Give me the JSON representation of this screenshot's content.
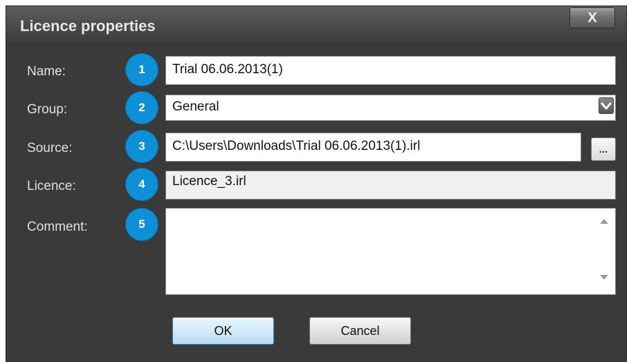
{
  "window": {
    "title": "Licence properties",
    "close_label": "X"
  },
  "fields": {
    "name": {
      "label": "Name:",
      "badge": "1",
      "value": "Trial 06.06.2013(1)"
    },
    "group": {
      "label": "Group:",
      "badge": "2",
      "value": "General"
    },
    "source": {
      "label": "Source:",
      "badge": "3",
      "value": "C:\\Users\\Downloads\\Trial 06.06.2013(1).irl",
      "browse_label": "..."
    },
    "licence": {
      "label": "Licence:",
      "badge": "4",
      "value": "Licence_3.irl"
    },
    "comment": {
      "label": "Comment:",
      "badge": "5",
      "value": ""
    }
  },
  "buttons": {
    "ok": "OK",
    "cancel": "Cancel"
  },
  "colors": {
    "badge": "#0f8fd6",
    "window_bg": "#3a3a3a"
  }
}
